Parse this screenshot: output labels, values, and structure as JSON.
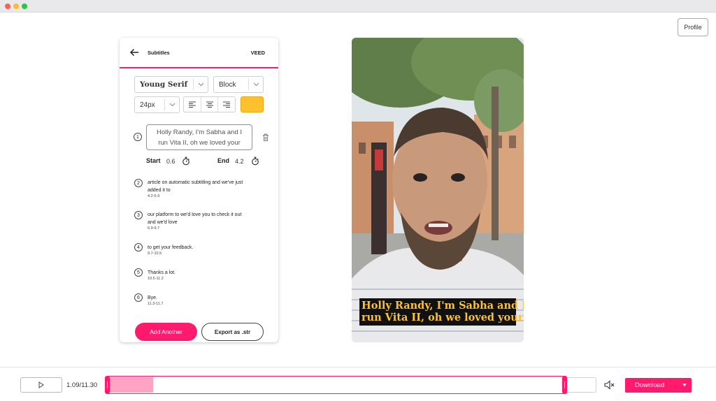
{
  "header": {
    "profile_label": "Profile"
  },
  "panel": {
    "title": "Subtitles",
    "brand": "VEED",
    "font_select": "Young Serif",
    "style_select": "Block",
    "size_select": "24px",
    "highlight_color": "#fec12e",
    "accent_color": "#ff1a6e",
    "active_subtitle": {
      "number": "1",
      "line1": "Holly Randy, I'm Sabha and I",
      "line2": "run Vita II, oh we loved your",
      "start_label": "Start",
      "start_value": "0.6",
      "end_label": "End",
      "end_value": "4.2"
    },
    "subtitles": [
      {
        "number": "2",
        "line1": "article on automatic subtitling and we've just",
        "line2": "added it to",
        "time": "4.2-6.9"
      },
      {
        "number": "3",
        "line1": "our platform to we'd love you to check it out",
        "line2": "and we'd love",
        "time": "6.9-9.7"
      },
      {
        "number": "4",
        "line1": "to get your feedback.",
        "line2": "",
        "time": "9.7-10.5"
      },
      {
        "number": "5",
        "line1": "Thanks a lot.",
        "line2": "",
        "time": "10.5-11.2"
      },
      {
        "number": "6",
        "line1": "Bye.",
        "line2": "",
        "time": "11.3-11.7"
      }
    ],
    "add_button": "Add Another",
    "export_button": "Export as .str"
  },
  "video": {
    "caption_line1": "Holly Randy, I'm Sabha and I",
    "caption_line2": "run Vita II, oh we loved your"
  },
  "player": {
    "timecode": "1.09/11.30",
    "progress_fraction": 0.0965,
    "download_label": "Download"
  }
}
